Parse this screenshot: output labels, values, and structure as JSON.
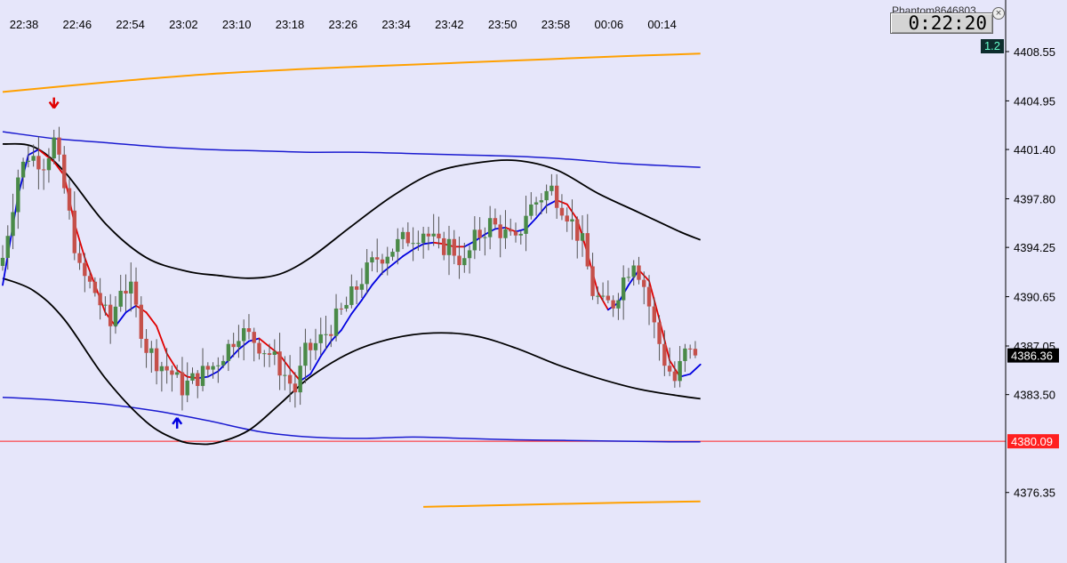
{
  "header": {
    "account": "Phantom8646803",
    "countdown": "0:22:20",
    "spread": "1.2"
  },
  "colors": {
    "background": "#e6e6fa",
    "bull_candle": "#4a8a48",
    "bear_candle": "#c5504a",
    "fast_ma": "#e00000",
    "fast_ma_alt": "#0000e0",
    "band": "#000000",
    "channel": "#1a1ad0",
    "outer_band": "#ffa000",
    "support_line": "#ff2020",
    "price_label_bg": "#000000"
  },
  "chart_data": {
    "type": "candlestick",
    "symbol_unit": "price",
    "x_ticks": [
      "22:38",
      "22:46",
      "22:54",
      "23:02",
      "23:10",
      "23:18",
      "23:26",
      "23:34",
      "23:42",
      "23:50",
      "23:58",
      "00:06",
      "00:14"
    ],
    "y_ticks": [
      4408.55,
      4404.95,
      4401.4,
      4397.8,
      4394.25,
      4390.65,
      4387.05,
      4383.5,
      4376.35
    ],
    "ylim": [
      4375.2,
      4410.6
    ],
    "current_price": 4386.36,
    "reference_level": 4380.09,
    "bar_interval_minutes": 1,
    "first_bar_time": "22:37",
    "close_path": [
      [
        0,
        4393.5
      ],
      [
        3,
        4399.5
      ],
      [
        5,
        4401.0
      ],
      [
        8,
        4400.5
      ],
      [
        10,
        4402.0
      ],
      [
        12,
        4398.5
      ],
      [
        15,
        4392.5
      ],
      [
        18,
        4391.0
      ],
      [
        21,
        4388.5
      ],
      [
        23,
        4391.5
      ],
      [
        25,
        4391.0
      ],
      [
        28,
        4387.0
      ],
      [
        30,
        4386.0
      ],
      [
        33,
        4385.0
      ],
      [
        35,
        4384.0
      ],
      [
        38,
        4384.8
      ],
      [
        41,
        4385.6
      ],
      [
        44,
        4387.0
      ],
      [
        46,
        4388.2
      ],
      [
        49,
        4387.5
      ],
      [
        52,
        4386.5
      ],
      [
        54,
        4385.5
      ],
      [
        57,
        4383.8
      ],
      [
        59,
        4386.5
      ],
      [
        62,
        4387.5
      ],
      [
        64,
        4388.5
      ],
      [
        67,
        4390.0
      ],
      [
        70,
        4392.0
      ],
      [
        73,
        4393.5
      ],
      [
        76,
        4394.2
      ],
      [
        79,
        4395.0
      ],
      [
        82,
        4395.5
      ],
      [
        85,
        4394.2
      ],
      [
        87,
        4394.5
      ],
      [
        90,
        4393.0
      ],
      [
        92,
        4394.8
      ],
      [
        95,
        4396.0
      ],
      [
        97,
        4395.5
      ],
      [
        100,
        4394.5
      ],
      [
        102,
        4396.8
      ],
      [
        105,
        4398.0
      ],
      [
        107,
        4398.5
      ],
      [
        110,
        4396.8
      ],
      [
        113,
        4394.5
      ],
      [
        115,
        4391.0
      ],
      [
        117,
        4390.0
      ],
      [
        119,
        4390.2
      ],
      [
        121,
        4392.0
      ],
      [
        123,
        4393.5
      ],
      [
        125,
        4391.5
      ],
      [
        127,
        4388.5
      ],
      [
        129,
        4386.0
      ],
      [
        131,
        4384.5
      ],
      [
        133,
        4386.5
      ],
      [
        135,
        4386.36
      ]
    ],
    "fast_ma": [
      [
        0,
        4391.5
      ],
      [
        3,
        4398.0
      ],
      [
        5,
        4401.0
      ],
      [
        7,
        4401.4
      ],
      [
        10,
        4400.5
      ],
      [
        12,
        4399.5
      ],
      [
        14,
        4396.0
      ],
      [
        16,
        4393.5
      ],
      [
        18,
        4391.5
      ],
      [
        20,
        4389.5
      ],
      [
        22,
        4388.5
      ],
      [
        24,
        4389.5
      ],
      [
        26,
        4390.0
      ],
      [
        28,
        4389.5
      ],
      [
        30,
        4388.5
      ],
      [
        32,
        4386.5
      ],
      [
        34,
        4385.3
      ],
      [
        36,
        4384.8
      ],
      [
        38,
        4384.7
      ],
      [
        40,
        4384.8
      ],
      [
        42,
        4385.2
      ],
      [
        44,
        4386.0
      ],
      [
        46,
        4386.8
      ],
      [
        48,
        4387.4
      ],
      [
        50,
        4387.6
      ],
      [
        52,
        4387.0
      ],
      [
        54,
        4386.4
      ],
      [
        56,
        4385.4
      ],
      [
        58,
        4384.5
      ],
      [
        60,
        4385.0
      ],
      [
        62,
        4386.3
      ],
      [
        64,
        4387.4
      ],
      [
        66,
        4388.2
      ],
      [
        68,
        4389.4
      ],
      [
        70,
        4390.4
      ],
      [
        72,
        4391.5
      ],
      [
        74,
        4392.4
      ],
      [
        76,
        4393.0
      ],
      [
        78,
        4393.6
      ],
      [
        80,
        4394.1
      ],
      [
        82,
        4394.5
      ],
      [
        84,
        4394.6
      ],
      [
        86,
        4394.5
      ],
      [
        88,
        4394.3
      ],
      [
        90,
        4394.3
      ],
      [
        92,
        4394.7
      ],
      [
        94,
        4395.2
      ],
      [
        96,
        4395.6
      ],
      [
        98,
        4395.7
      ],
      [
        100,
        4395.4
      ],
      [
        102,
        4395.6
      ],
      [
        104,
        4396.4
      ],
      [
        106,
        4397.3
      ],
      [
        108,
        4397.7
      ],
      [
        110,
        4397.4
      ],
      [
        112,
        4396.3
      ],
      [
        114,
        4393.8
      ],
      [
        116,
        4391.0
      ],
      [
        118,
        4389.7
      ],
      [
        120,
        4390.2
      ],
      [
        122,
        4391.5
      ],
      [
        124,
        4392.6
      ],
      [
        126,
        4391.8
      ],
      [
        128,
        4389.0
      ],
      [
        130,
        4386.0
      ],
      [
        132,
        4384.8
      ],
      [
        134,
        4385.0
      ],
      [
        136,
        4385.7
      ]
    ],
    "upper_band": [
      [
        0,
        4401.8
      ],
      [
        6,
        4401.6
      ],
      [
        12,
        4399.8
      ],
      [
        20,
        4396.0
      ],
      [
        28,
        4393.5
      ],
      [
        36,
        4392.5
      ],
      [
        42,
        4392.2
      ],
      [
        48,
        4392.0
      ],
      [
        54,
        4392.3
      ],
      [
        60,
        4393.5
      ],
      [
        68,
        4395.8
      ],
      [
        76,
        4398.0
      ],
      [
        84,
        4399.7
      ],
      [
        92,
        4400.4
      ],
      [
        100,
        4400.6
      ],
      [
        108,
        4399.9
      ],
      [
        116,
        4398.2
      ],
      [
        124,
        4396.8
      ],
      [
        132,
        4395.4
      ],
      [
        136,
        4394.8
      ]
    ],
    "lower_band": [
      [
        0,
        4392.0
      ],
      [
        6,
        4391.1
      ],
      [
        12,
        4389.0
      ],
      [
        20,
        4384.7
      ],
      [
        28,
        4381.5
      ],
      [
        34,
        4380.2
      ],
      [
        38,
        4379.9
      ],
      [
        42,
        4380.0
      ],
      [
        48,
        4380.9
      ],
      [
        54,
        4382.8
      ],
      [
        60,
        4384.8
      ],
      [
        68,
        4386.6
      ],
      [
        76,
        4387.6
      ],
      [
        84,
        4388.0
      ],
      [
        92,
        4387.8
      ],
      [
        100,
        4386.9
      ],
      [
        108,
        4385.7
      ],
      [
        116,
        4384.7
      ],
      [
        124,
        4383.9
      ],
      [
        132,
        4383.4
      ],
      [
        136,
        4383.2
      ]
    ],
    "upper_channel": [
      [
        0,
        4402.7
      ],
      [
        10,
        4402.2
      ],
      [
        20,
        4401.9
      ],
      [
        30,
        4401.6
      ],
      [
        40,
        4401.4
      ],
      [
        50,
        4401.3
      ],
      [
        60,
        4401.2
      ],
      [
        70,
        4401.2
      ],
      [
        80,
        4401.1
      ],
      [
        90,
        4401.0
      ],
      [
        100,
        4400.9
      ],
      [
        110,
        4400.7
      ],
      [
        120,
        4400.4
      ],
      [
        130,
        4400.2
      ],
      [
        136,
        4400.1
      ]
    ],
    "lower_channel": [
      [
        0,
        4383.3
      ],
      [
        10,
        4383.1
      ],
      [
        20,
        4382.8
      ],
      [
        30,
        4382.3
      ],
      [
        40,
        4381.6
      ],
      [
        50,
        4380.8
      ],
      [
        60,
        4380.4
      ],
      [
        70,
        4380.3
      ],
      [
        80,
        4380.4
      ],
      [
        90,
        4380.3
      ],
      [
        100,
        4380.2
      ],
      [
        110,
        4380.15
      ],
      [
        120,
        4380.1
      ],
      [
        130,
        4380.05
      ],
      [
        136,
        4380.05
      ]
    ],
    "outer_upper": [
      [
        0,
        4405.6
      ],
      [
        20,
        4406.3
      ],
      [
        40,
        4406.9
      ],
      [
        60,
        4407.3
      ],
      [
        80,
        4407.6
      ],
      [
        100,
        4407.9
      ],
      [
        120,
        4408.2
      ],
      [
        136,
        4408.4
      ]
    ],
    "outer_lower": [
      [
        82,
        4375.3
      ],
      [
        100,
        4375.45
      ],
      [
        120,
        4375.6
      ],
      [
        136,
        4375.7
      ]
    ],
    "signals": [
      {
        "type": "sell",
        "bar": 10,
        "price": 4405.2
      },
      {
        "type": "buy",
        "bar": 34,
        "price": 4381.8
      }
    ],
    "grid": false
  }
}
